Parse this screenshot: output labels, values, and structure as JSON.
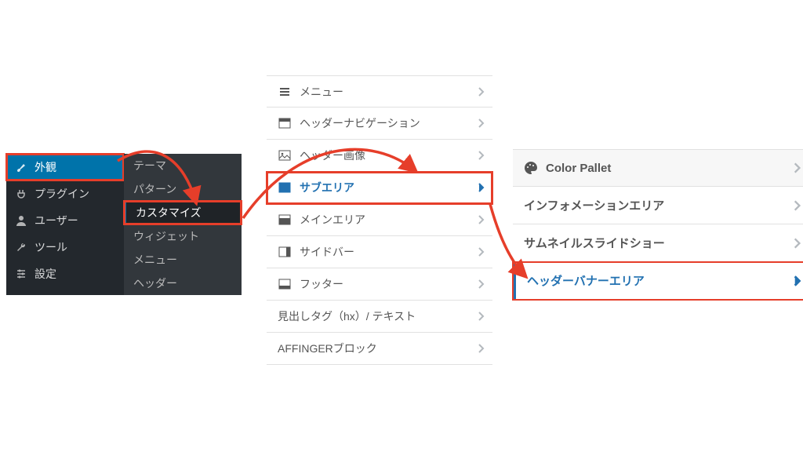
{
  "sidebar": {
    "main": [
      {
        "name": "appearance",
        "label": "外観",
        "icon": "brush",
        "current": true
      },
      {
        "name": "plugins",
        "label": "プラグイン",
        "icon": "plug"
      },
      {
        "name": "users",
        "label": "ユーザー",
        "icon": "user"
      },
      {
        "name": "tools",
        "label": "ツール",
        "icon": "wrench"
      },
      {
        "name": "settings",
        "label": "設定",
        "icon": "sliders"
      }
    ],
    "sub": [
      {
        "name": "themes",
        "label": "テーマ"
      },
      {
        "name": "patterns",
        "label": "パターン"
      },
      {
        "name": "customize",
        "label": "カスタマイズ",
        "current": true
      },
      {
        "name": "widgets",
        "label": "ウィジェット"
      },
      {
        "name": "menus",
        "label": "メニュー"
      },
      {
        "name": "header",
        "label": "ヘッダー"
      }
    ]
  },
  "customizer": {
    "items": [
      {
        "name": "menu",
        "label": "メニュー",
        "icon": "hamburger"
      },
      {
        "name": "header-nav",
        "label": "ヘッダーナビゲーション",
        "icon": "layout"
      },
      {
        "name": "header-img",
        "label": "ヘッダー画像",
        "icon": "picture"
      },
      {
        "name": "subarea",
        "label": "サブエリア",
        "icon": "layout",
        "accent": true,
        "highlight": true
      },
      {
        "name": "mainarea",
        "label": "メインエリア",
        "icon": "layout"
      },
      {
        "name": "sidebar",
        "label": "サイドバー",
        "icon": "layout"
      },
      {
        "name": "footer",
        "label": "フッター",
        "icon": "layout"
      },
      {
        "name": "hx-text",
        "label": "見出しタグ（hx）/ テキスト"
      },
      {
        "name": "affinger",
        "label": "AFFINGERブロック"
      }
    ]
  },
  "subarea": {
    "items": [
      {
        "name": "color-pallet",
        "label": "Color Pallet",
        "icon": "palette"
      },
      {
        "name": "info-area",
        "label": "インフォメーションエリア"
      },
      {
        "name": "thumb-slide",
        "label": "サムネイルスライドショー"
      },
      {
        "name": "header-banner",
        "label": "ヘッダーバナーエリア",
        "accent": true,
        "highlight": true
      }
    ]
  },
  "colors": {
    "accent": "#2271b1",
    "highlight": "#e63e2a"
  }
}
